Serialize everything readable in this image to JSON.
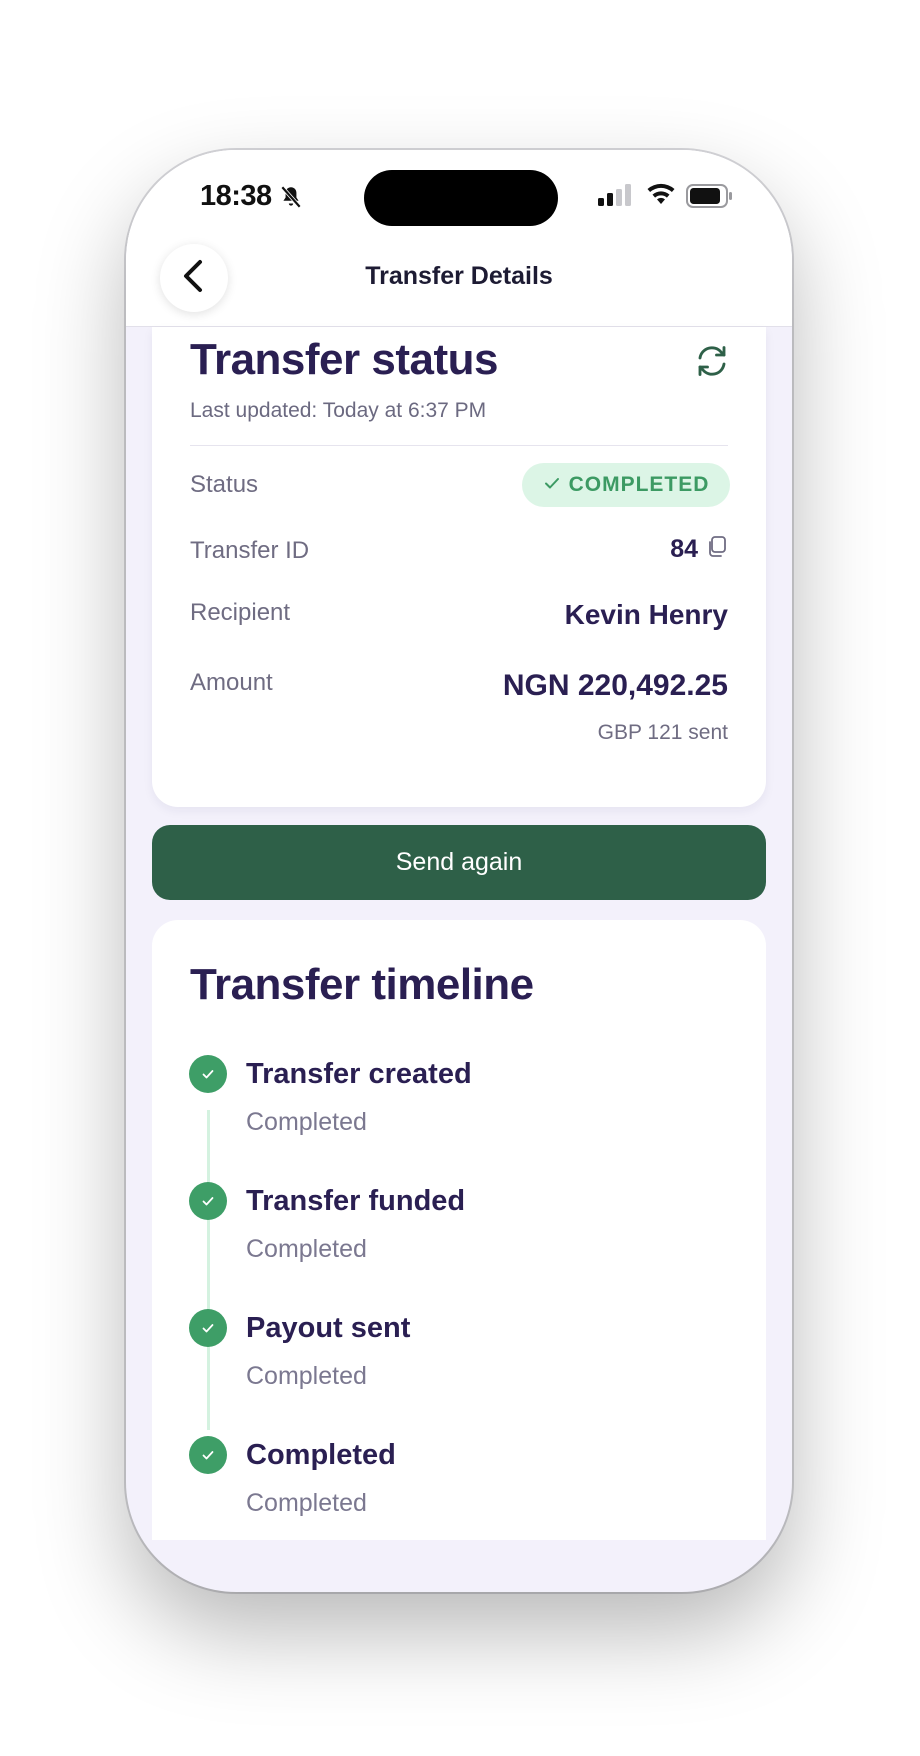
{
  "status_bar": {
    "time": "18:38"
  },
  "nav": {
    "title": "Transfer Details"
  },
  "status_card": {
    "title": "Transfer status",
    "last_updated": "Last updated: Today at 6:37 PM",
    "rows": {
      "status_label": "Status",
      "status_value": "COMPLETED",
      "id_label": "Transfer ID",
      "id_value": "84",
      "recipient_label": "Recipient",
      "recipient_value": "Kevin Henry",
      "amount_label": "Amount",
      "amount_value": "NGN 220,492.25",
      "amount_sent": "GBP 121 sent"
    }
  },
  "actions": {
    "send_again": "Send again"
  },
  "timeline": {
    "title": "Transfer timeline",
    "steps": [
      {
        "label": "Transfer created",
        "status": "Completed"
      },
      {
        "label": "Transfer funded",
        "status": "Completed"
      },
      {
        "label": "Payout sent",
        "status": "Completed"
      },
      {
        "label": "Completed",
        "status": "Completed"
      }
    ]
  },
  "colors": {
    "brand_green": "#2e6048",
    "success_green": "#3e9e67",
    "badge_bg": "#dcf5e6",
    "text_primary": "#2a1f52",
    "background": "#f3f1fb"
  },
  "icons": [
    "bell-slash-icon",
    "signal-icon",
    "wifi-icon",
    "battery-icon",
    "chevron-left-icon",
    "refresh-icon",
    "check-icon",
    "copy-icon"
  ]
}
